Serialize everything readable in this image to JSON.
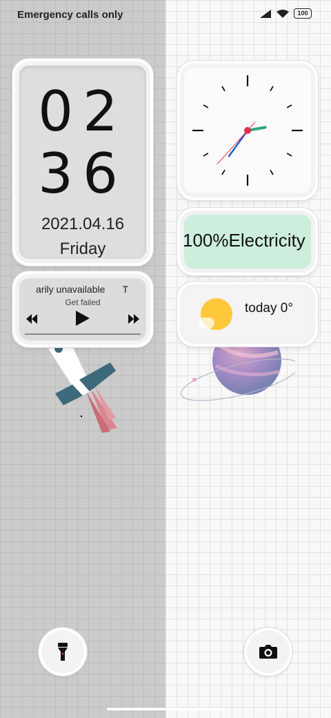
{
  "status_bar": {
    "carrier_text": "Emergency calls only",
    "battery_level": "100",
    "icons": [
      "signal-icon",
      "wifi-icon",
      "battery-icon"
    ]
  },
  "time_widget": {
    "hour": "02",
    "minute": "36",
    "date": "2021.04.16",
    "weekday": "Friday"
  },
  "music_widget": {
    "song_title": "arily unavailable",
    "song_extra": "T",
    "status": "Get failed",
    "controls": [
      "previous-icon",
      "play-icon",
      "next-icon"
    ]
  },
  "battery_widget": {
    "text": "100%Electricity",
    "color": "#cdeedd"
  },
  "weather_widget": {
    "text": "today 0°",
    "sun_color": "#ffc83a"
  },
  "bottom_buttons": {
    "left": "flashlight-icon",
    "right": "camera-icon"
  }
}
